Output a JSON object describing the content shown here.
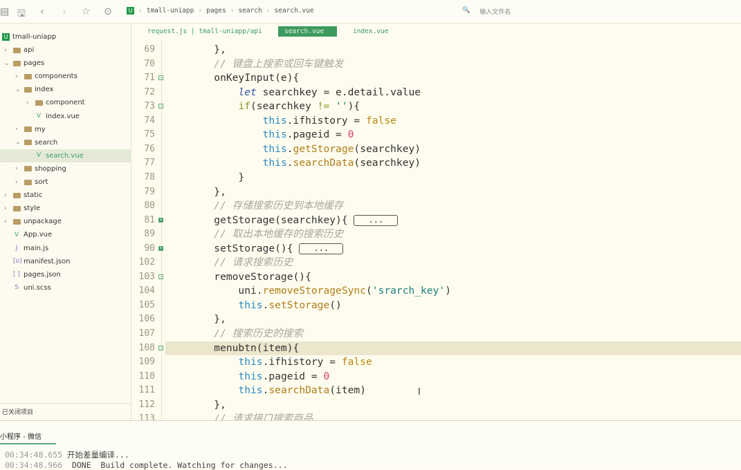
{
  "toolbar": {
    "icons": [
      "file-icon",
      "save-icon",
      "back-icon",
      "forward-icon",
      "star-icon",
      "run-icon"
    ],
    "breadcrumb": [
      "tmall-uniapp",
      "pages",
      "search",
      "search.vue"
    ],
    "file_search_placeholder": "输入文件名"
  },
  "sidebar": {
    "project": "tmall-uniapp",
    "items": [
      {
        "label": "api",
        "type": "folder",
        "depth": 0,
        "expanded": false
      },
      {
        "label": "pages",
        "type": "folder",
        "depth": 0,
        "expanded": true
      },
      {
        "label": "components",
        "type": "folder",
        "depth": 1,
        "expanded": false
      },
      {
        "label": "index",
        "type": "folder",
        "depth": 1,
        "expanded": true
      },
      {
        "label": "component",
        "type": "folder",
        "depth": 2,
        "expanded": false
      },
      {
        "label": "index.vue",
        "type": "vue",
        "depth": 2
      },
      {
        "label": "my",
        "type": "folder",
        "depth": 1,
        "expanded": false
      },
      {
        "label": "search",
        "type": "folder",
        "depth": 1,
        "expanded": true
      },
      {
        "label": "search.vue",
        "type": "vue",
        "depth": 2,
        "selected": true
      },
      {
        "label": "shopping",
        "type": "folder",
        "depth": 1,
        "expanded": false
      },
      {
        "label": "sort",
        "type": "folder",
        "depth": 1,
        "expanded": false
      },
      {
        "label": "static",
        "type": "folder",
        "depth": 0,
        "expanded": false
      },
      {
        "label": "style",
        "type": "folder",
        "depth": 0,
        "expanded": false
      },
      {
        "label": "unpackage",
        "type": "folder",
        "depth": 0,
        "expanded": false
      },
      {
        "label": "App.vue",
        "type": "vue",
        "depth": 0
      },
      {
        "label": "main.js",
        "type": "js",
        "depth": 0
      },
      {
        "label": "manifest.json",
        "type": "manifest",
        "depth": 0
      },
      {
        "label": "pages.json",
        "type": "json",
        "depth": 0
      },
      {
        "label": "uni.scss",
        "type": "scss",
        "depth": 0
      }
    ],
    "closed_projects": "已关闭项目"
  },
  "tabs": [
    {
      "label": "request.js | tmall-uniapp/api"
    },
    {
      "label": "search.vue",
      "active": true
    },
    {
      "label": "index.vue"
    }
  ],
  "code": [
    {
      "n": "69",
      "t": [
        [
          "        },",
          ""
        ]
      ]
    },
    {
      "n": "70",
      "t": [
        [
          "        // 键盘上搜索或回车键触发",
          "cm"
        ]
      ]
    },
    {
      "n": "71",
      "fold": "open",
      "t": [
        [
          "        onKeyInput(e){",
          ""
        ]
      ]
    },
    {
      "n": "72",
      "t": [
        [
          "            ",
          ""
        ],
        [
          "let",
          "let"
        ],
        [
          " searchkey = e.detail.value",
          ""
        ]
      ]
    },
    {
      "n": "73",
      "fold": "open",
      "t": [
        [
          "            ",
          ""
        ],
        [
          "if",
          "if"
        ],
        [
          "(searchkey ",
          ""
        ],
        [
          "!=",
          "if"
        ],
        [
          " ",
          ""
        ],
        [
          "''",
          "str"
        ],
        [
          "){",
          ""
        ]
      ]
    },
    {
      "n": "74",
      "t": [
        [
          "                ",
          ""
        ],
        [
          "this",
          "kw"
        ],
        [
          ".ifhistory = ",
          ""
        ],
        [
          "false",
          "bool"
        ]
      ]
    },
    {
      "n": "75",
      "t": [
        [
          "                ",
          ""
        ],
        [
          "this",
          "kw"
        ],
        [
          ".pageid = ",
          ""
        ],
        [
          "0",
          "num"
        ]
      ]
    },
    {
      "n": "76",
      "t": [
        [
          "                ",
          ""
        ],
        [
          "this",
          "kw"
        ],
        [
          ".",
          ""
        ],
        [
          "getStorage",
          "fn"
        ],
        [
          "(searchkey)",
          ""
        ]
      ]
    },
    {
      "n": "77",
      "t": [
        [
          "                ",
          ""
        ],
        [
          "this",
          "kw"
        ],
        [
          ".",
          ""
        ],
        [
          "searchData",
          "fn"
        ],
        [
          "(searchkey)",
          ""
        ]
      ]
    },
    {
      "n": "78",
      "t": [
        [
          "            }",
          ""
        ]
      ]
    },
    {
      "n": "79",
      "t": [
        [
          "        },",
          ""
        ]
      ]
    },
    {
      "n": "80",
      "t": [
        [
          "        // 存储搜索历史到本地缓存",
          "cm"
        ]
      ]
    },
    {
      "n": "81",
      "fold": "closed",
      "t": [
        [
          "        getStorage(searchkey){ ",
          ""
        ]
      ],
      "collapsed": "..."
    },
    {
      "n": "89",
      "t": [
        [
          "        // 取出本地缓存的搜索历史",
          "cm"
        ]
      ]
    },
    {
      "n": "90",
      "fold": "closed",
      "t": [
        [
          "        setStorage(){ ",
          ""
        ]
      ],
      "collapsed": "..."
    },
    {
      "n": "102",
      "t": [
        [
          "        // 请求搜索历史",
          "cm"
        ]
      ]
    },
    {
      "n": "103",
      "fold": "open",
      "t": [
        [
          "        removeStorage(){",
          ""
        ]
      ]
    },
    {
      "n": "104",
      "t": [
        [
          "            uni.",
          ""
        ],
        [
          "removeStorageSync",
          "fn"
        ],
        [
          "(",
          ""
        ],
        [
          "'srarch_key'",
          "str"
        ],
        [
          ")",
          ""
        ]
      ]
    },
    {
      "n": "105",
      "t": [
        [
          "            ",
          ""
        ],
        [
          "this",
          "kw"
        ],
        [
          ".",
          ""
        ],
        [
          "setStorage",
          "fn"
        ],
        [
          "()",
          ""
        ]
      ]
    },
    {
      "n": "106",
      "t": [
        [
          "        },",
          ""
        ]
      ]
    },
    {
      "n": "107",
      "t": [
        [
          "        // 搜索历史的搜索",
          "cm"
        ]
      ]
    },
    {
      "n": "108",
      "fold": "open",
      "current": true,
      "t": [
        [
          "        menubtn(item){",
          ""
        ]
      ]
    },
    {
      "n": "109",
      "t": [
        [
          "            ",
          ""
        ],
        [
          "this",
          "kw"
        ],
        [
          ".ifhistory = ",
          ""
        ],
        [
          "false",
          "bool"
        ]
      ]
    },
    {
      "n": "110",
      "t": [
        [
          "            ",
          ""
        ],
        [
          "this",
          "kw"
        ],
        [
          ".pageid = ",
          ""
        ],
        [
          "0",
          "num"
        ]
      ]
    },
    {
      "n": "111",
      "t": [
        [
          "            ",
          ""
        ],
        [
          "this",
          "kw"
        ],
        [
          ".",
          ""
        ],
        [
          "searchData",
          "fn"
        ],
        [
          "(item)",
          ""
        ]
      ]
    },
    {
      "n": "112",
      "t": [
        [
          "        },",
          ""
        ]
      ]
    },
    {
      "n": "113",
      "t": [
        [
          "        // 请求接口搜索商品",
          "cm"
        ]
      ]
    }
  ],
  "console": {
    "tab": "小程序 - 微信",
    "lines": [
      {
        "time": "00:34:48.655",
        "msg": "开始差量编译..."
      },
      {
        "time": "00:34:48.966",
        "msg": " DONE  Build complete. Watching for changes..."
      }
    ]
  },
  "colors": {
    "accent": "#3e9a5e",
    "background": "#fefcee",
    "current_line": "#ebe6cc"
  }
}
